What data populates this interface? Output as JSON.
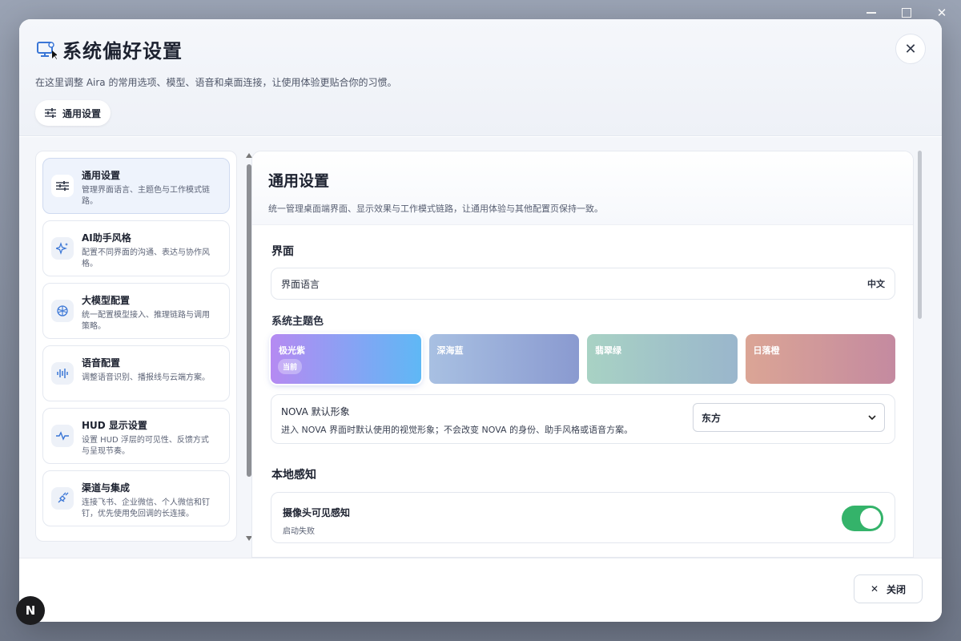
{
  "dialog": {
    "title": "系统偏好设置",
    "subtitle": "在这里调整 Aira 的常用选项、模型、语音和桌面连接，让使用体验更贴合你的习惯。",
    "chip_label": "通用设置",
    "close_label": "关闭"
  },
  "sidebar": {
    "items": [
      {
        "title": "通用设置",
        "desc": "管理界面语言、主题色与工作模式链路。",
        "icon": "sliders-icon"
      },
      {
        "title": "AI助手风格",
        "desc": "配置不同界面的沟通、表达与协作风格。",
        "icon": "sparkles-icon"
      },
      {
        "title": "大模型配置",
        "desc": "统一配置模型接入、推理链路与调用策略。",
        "icon": "brain-icon"
      },
      {
        "title": "语音配置",
        "desc": "调整语音识别、播报线与云端方案。",
        "icon": "waveform-icon"
      },
      {
        "title": "HUD 显示设置",
        "desc": "设置 HUD 浮层的可见性、反馈方式与呈现节奏。",
        "icon": "pulse-icon"
      },
      {
        "title": "渠道与集成",
        "desc": "连接飞书、企业微信、个人微信和钉钉，优先使用免回调的长连接。",
        "icon": "plug-icon"
      }
    ]
  },
  "main": {
    "title": "通用设置",
    "subtitle": "统一管理桌面端界面、显示效果与工作模式链路，让通用体验与其他配置页保持一致。",
    "interface_section": "界面",
    "language_label": "界面语言",
    "language_value": "中文",
    "theme_label": "系统主题色",
    "themes": [
      {
        "name": "极光紫",
        "badge": "当前",
        "from": "#b58af2",
        "to": "#5fb8f5"
      },
      {
        "name": "深海蓝",
        "from": "#a8c0e2",
        "to": "#8a9ad0"
      },
      {
        "name": "翡翠绿",
        "from": "#a8d2c4",
        "to": "#9ab6cc"
      },
      {
        "name": "日落橙",
        "from": "#dba595",
        "to": "#c48aa0"
      }
    ],
    "nova_title": "NOVA 默认形象",
    "nova_desc": "进入 NOVA 界面时默认使用的视觉形象；不会改变 NOVA 的身份、助手风格或语音方案。",
    "nova_value": "东方",
    "local_section": "本地感知",
    "camera_title": "摄像头可见感知",
    "camera_status": "启动失败"
  },
  "footer_badge": "N"
}
